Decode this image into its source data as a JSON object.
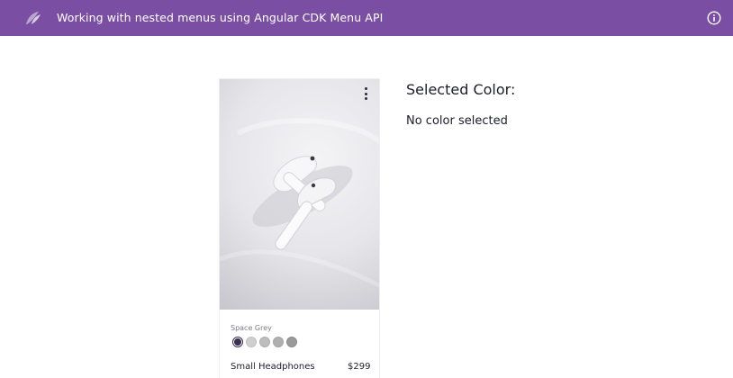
{
  "header": {
    "title": "Working with nested menus using Angular CDK Menu API",
    "background_color": "#7a4fa3",
    "logo_icon": "leaf-logo-icon",
    "info_icon": "info-circle-icon"
  },
  "product_card": {
    "menu_icon": "more-vert-icon",
    "image_subject": "white wireless earbuds",
    "color_label": "Space Grey",
    "swatches": [
      {
        "color": "#3b2f4f",
        "selected": true
      },
      {
        "color": "#cfcfcf",
        "selected": false
      },
      {
        "color": "#bdbdbd",
        "selected": false
      },
      {
        "color": "#b0b0b0",
        "selected": false
      },
      {
        "color": "#9a9a9a",
        "selected": false
      }
    ],
    "name": "Small Headphones",
    "price": "$299"
  },
  "selection": {
    "heading": "Selected Color:",
    "value": "No color selected"
  }
}
